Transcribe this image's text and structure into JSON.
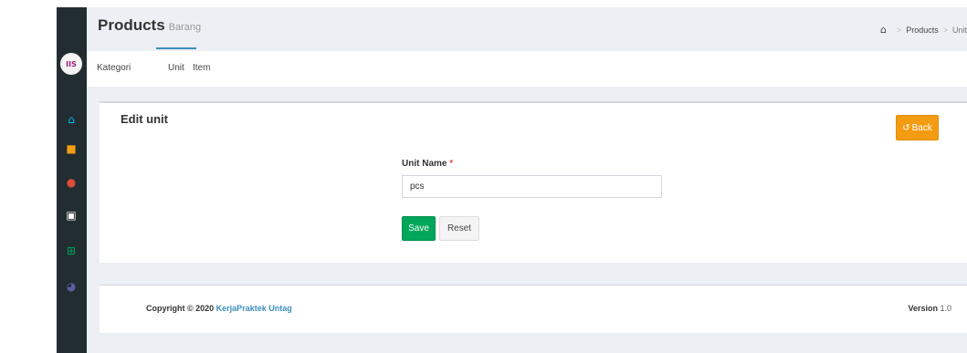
{
  "sidebar": {
    "logo_text": "IIS",
    "icons": [
      {
        "name": "home-icon",
        "glyph": "⌂",
        "color": "#00c0ef"
      },
      {
        "name": "truck-icon",
        "glyph": "■",
        "color": "#f39c12"
      },
      {
        "name": "users-icon",
        "glyph": "●",
        "color": "#dd4b39"
      },
      {
        "name": "archive-icon",
        "glyph": "▣",
        "color": "#ffffff"
      },
      {
        "name": "cart-icon",
        "glyph": "⊞",
        "color": "#00a65a"
      },
      {
        "name": "chart-icon",
        "glyph": "◕",
        "color": "#605ca8"
      }
    ]
  },
  "header": {
    "title": "Products",
    "subtitle": "Barang",
    "breadcrumb": {
      "home_icon": "⌂",
      "items": [
        "Products",
        "Unit"
      ]
    }
  },
  "tabs": [
    {
      "label": "Kategori"
    },
    {
      "label": "Unit"
    },
    {
      "label": "Item"
    }
  ],
  "box": {
    "title": "Edit unit",
    "back_icon": "↺",
    "back_label": "Back",
    "field_label": "Unit Name",
    "field_required": "*",
    "field_value": "pcs",
    "save_label": "Save",
    "reset_label": "Reset"
  },
  "footer": {
    "copyright_prefix": "Copyright © 2020",
    "copyright_link": "KerjaPraktek Untag",
    "version_label": "Version",
    "version_value": "1.0"
  },
  "colors": {
    "accent": "#3c8dbc",
    "warning": "#f39c12",
    "success": "#00a65a",
    "sidebar_bg": "#222d32"
  }
}
